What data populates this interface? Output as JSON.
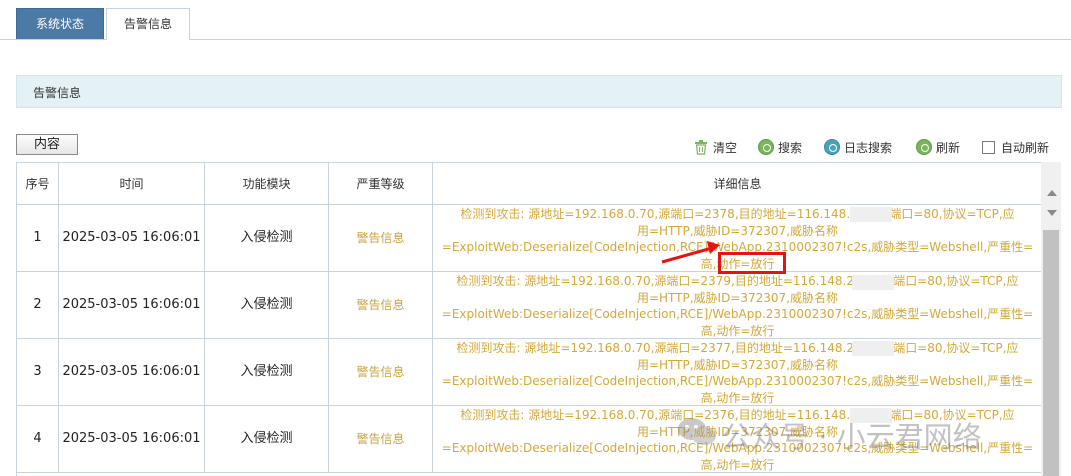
{
  "tabs": [
    {
      "label": "系统状态",
      "active": true
    },
    {
      "label": "告警信息",
      "active": false
    }
  ],
  "section_title": "告警信息",
  "content_button": "内容",
  "toolbar": {
    "clear": "清空",
    "search": "搜索",
    "log_search": "日志搜索",
    "refresh": "刷新",
    "auto_refresh": "自动刷新"
  },
  "table": {
    "headers": [
      "序号",
      "时间",
      "功能模块",
      "严重等级",
      "详细信息"
    ],
    "rows": [
      {
        "seq": "1",
        "time": "2025-03-05 16:06:01",
        "module": "入侵检测",
        "level": "警告信息",
        "detail": [
          "检测到攻击: 源地址=192.168.0.70,源端口=2378,目的地址=116.148.2          ,目的端口=80,协议=TCP,应",
          "用=HTTP,威胁ID=372307,威胁名称",
          "=ExploitWeb:Deserialize[CodeInjection,RCE]/WebApp.2310002307!c2s,威胁类型=Webshell,严重性=",
          "高,动作=放行"
        ]
      },
      {
        "seq": "2",
        "time": "2025-03-05 16:06:01",
        "module": "入侵检测",
        "level": "警告信息",
        "detail": [
          "检测到攻击: 源地址=192.168.0.70,源端口=2379,目的地址=116.148.22          ,目的端口=80,协议=TCP,应",
          "用=HTTP,威胁ID=372307,威胁名称",
          "=ExploitWeb:Deserialize[CodeInjection,RCE]/WebApp.2310002307!c2s,威胁类型=Webshell,严重性=",
          "高,动作=放行"
        ]
      },
      {
        "seq": "3",
        "time": "2025-03-05 16:06:01",
        "module": "入侵检测",
        "level": "警告信息",
        "detail": [
          "检测到攻击: 源地址=192.168.0.70,源端口=2377,目的地址=116.148.22          ,目的端口=80,协议=TCP,应",
          "用=HTTP,威胁ID=372307,威胁名称",
          "=ExploitWeb:Deserialize[CodeInjection,RCE]/WebApp.2310002307!c2s,威胁类型=Webshell,严重性=",
          "高,动作=放行"
        ]
      },
      {
        "seq": "4",
        "time": "2025-03-05 16:06:01",
        "module": "入侵检测",
        "level": "警告信息",
        "detail": [
          "检测到攻击: 源地址=192.168.0.70,源端口=2376,目的地址=116.148.2          ,目的端口=80,协议=TCP,应",
          "用=HTTP,威胁ID=372307,威胁名称",
          "=ExploitWeb:Deserialize[CodeInjection,RCE]/WebApp.2310002307!c2s,威胁类型=Webshell,严重性=",
          "高,动作=放行"
        ]
      }
    ]
  },
  "watermark": "公众号 · 小云君网络",
  "colors": {
    "tab_active": "#4c7aa6",
    "section_bg": "#e4f1f5",
    "detail_text": "#d3a83a",
    "annotation": "#e51414"
  }
}
